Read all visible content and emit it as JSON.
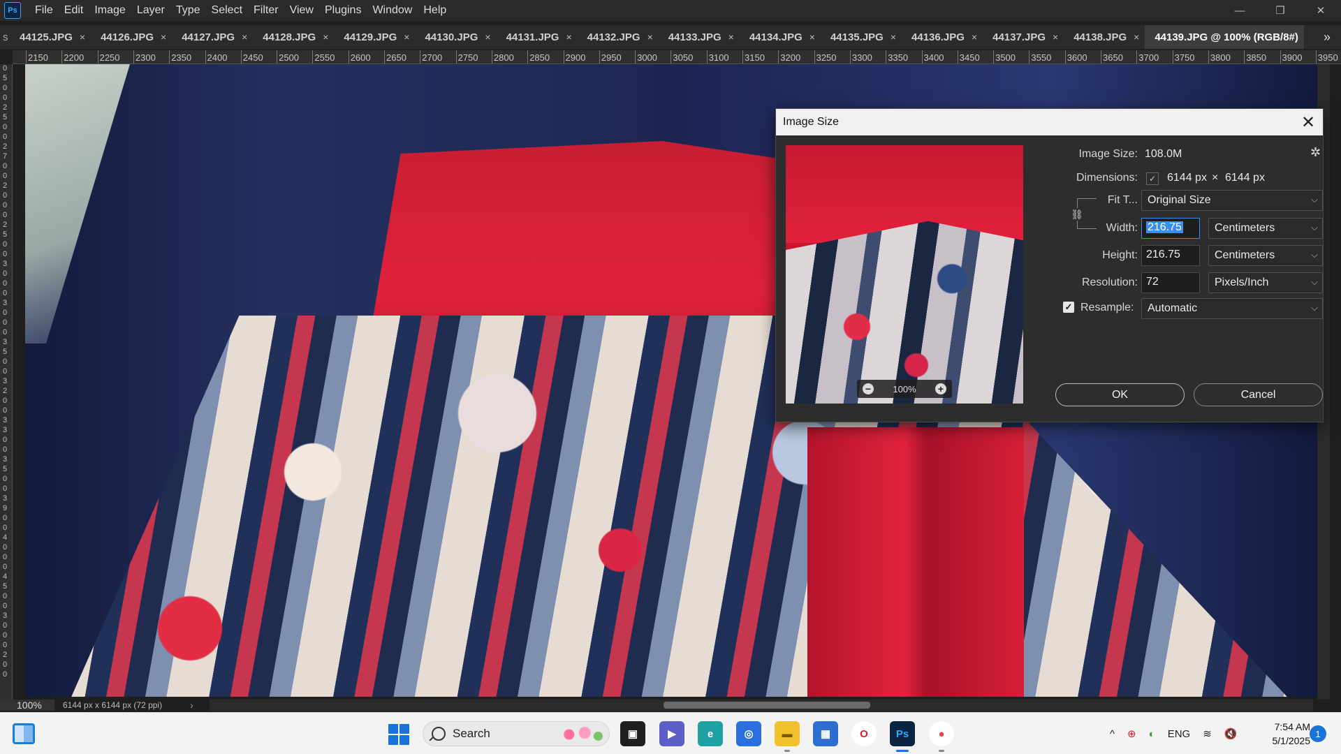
{
  "app": {
    "logo": "Ps"
  },
  "menu": [
    "File",
    "Edit",
    "Image",
    "Layer",
    "Type",
    "Select",
    "Filter",
    "View",
    "Plugins",
    "Window",
    "Help"
  ],
  "window_controls": {
    "minimize": "—",
    "restore": "❐",
    "close": "✕"
  },
  "tabs": {
    "left_overflow": "s",
    "items": [
      "44125.JPG",
      "44126.JPG",
      "44127.JPG",
      "44128.JPG",
      "44129.JPG",
      "44130.JPG",
      "44131.JPG",
      "44132.JPG",
      "44133.JPG",
      "44134.JPG",
      "44135.JPG",
      "44136.JPG",
      "44137.JPG",
      "44138.JPG"
    ],
    "active": "44139.JPG @ 100% (RGB/8#)",
    "close_glyph": "×",
    "more_glyph": "»"
  },
  "ruler": {
    "h_ticks": [
      "2150",
      "2200",
      "2250",
      "2300",
      "2350",
      "2400",
      "2450",
      "2500",
      "2550",
      "2600",
      "2650",
      "2700",
      "2750",
      "2800",
      "2850",
      "2900",
      "2950",
      "3000",
      "3050",
      "3100",
      "3150",
      "3200",
      "3250",
      "3300",
      "3350",
      "3400",
      "3450",
      "3500",
      "3550",
      "3600",
      "3650",
      "3700",
      "3750",
      "3800",
      "3850",
      "3900",
      "3950"
    ],
    "v_ticks": [
      "0",
      "5",
      "0",
      "0",
      "2",
      "5",
      "0",
      "0",
      "2",
      "7",
      "0",
      "0",
      "2",
      "0",
      "0",
      "0",
      "2",
      "5",
      "0",
      "0",
      "3",
      "0",
      "0",
      "0",
      "3",
      "0",
      "0",
      "0",
      "3",
      "5",
      "0",
      "0",
      "3",
      "2",
      "0",
      "0",
      "3",
      "3",
      "0",
      "0",
      "3",
      "5",
      "0",
      "0",
      "3",
      "9",
      "0",
      "0",
      "4",
      "0",
      "0",
      "0",
      "4",
      "5",
      "0",
      "0",
      "3",
      "0",
      "0",
      "0",
      "2",
      "0",
      "0"
    ]
  },
  "status": {
    "zoom": "100%",
    "doc_info": "6144 px x 6144 px (72 ppi)",
    "arrow": "›"
  },
  "dialog": {
    "title": "Image Size",
    "close_glyph": "✕",
    "image_size_label": "Image Size:",
    "image_size_value": "108.0M",
    "gear_glyph": "✲",
    "dimensions_label": "Dimensions:",
    "dim_toggle_glyph": "✓",
    "dim_width": "6144 px",
    "dim_times": "×",
    "dim_height": "6144 px",
    "fit_label": "Fit T...",
    "fit_value": "Original Size",
    "width_label": "Width:",
    "width_value": "216.75",
    "width_unit": "Centimeters",
    "height_label": "Height:",
    "height_value": "216.75",
    "height_unit": "Centimeters",
    "resolution_label": "Resolution:",
    "resolution_value": "72",
    "resolution_unit": "Pixels/Inch",
    "resample_check_glyph": "✓",
    "resample_label": "Resample:",
    "resample_value": "Automatic",
    "chevron": "⌵",
    "link_glyph": "⛓",
    "preview_zoom": "100%",
    "zoom_out": "−",
    "zoom_in": "+",
    "ok": "OK",
    "cancel": "Cancel"
  },
  "taskbar": {
    "search_placeholder": "Search",
    "apps": [
      {
        "name": "task-view",
        "glyph": "▣",
        "color": "#1f1f1f",
        "fg": "#ffffff"
      },
      {
        "name": "teams",
        "glyph": "▶",
        "color": "#5b5fc7",
        "fg": "#ffffff"
      },
      {
        "name": "edge",
        "glyph": "e",
        "color": "#1fa0a3",
        "fg": "#ffffff"
      },
      {
        "name": "snipping-tool",
        "glyph": "◎",
        "color": "#2a6fdb",
        "fg": "#ffffff"
      },
      {
        "name": "file-explorer",
        "glyph": "▬",
        "color": "#f2c12e",
        "fg": "#7a5a00"
      },
      {
        "name": "microsoft-store",
        "glyph": "▦",
        "color": "#2c6fd1",
        "fg": "#ffffff"
      },
      {
        "name": "opera",
        "glyph": "O",
        "color": "#ffffff",
        "fg": "#e0182d"
      },
      {
        "name": "photoshop",
        "glyph": "Ps",
        "color": "#0b2440",
        "fg": "#31a8ff"
      },
      {
        "name": "chrome",
        "glyph": "●",
        "color": "#ffffff",
        "fg": "#e8453c"
      }
    ],
    "tray": {
      "chevron": "^",
      "language": "ENG",
      "wifi": "≋",
      "volume": "🔇"
    },
    "clock_time": "7:54 AM",
    "clock_date": "5/1/2025",
    "notifications": "1"
  },
  "colors": {
    "accent": "#3b8eea",
    "windows_blue": "#1a73d9",
    "ps_blue": "#31a8ff"
  }
}
